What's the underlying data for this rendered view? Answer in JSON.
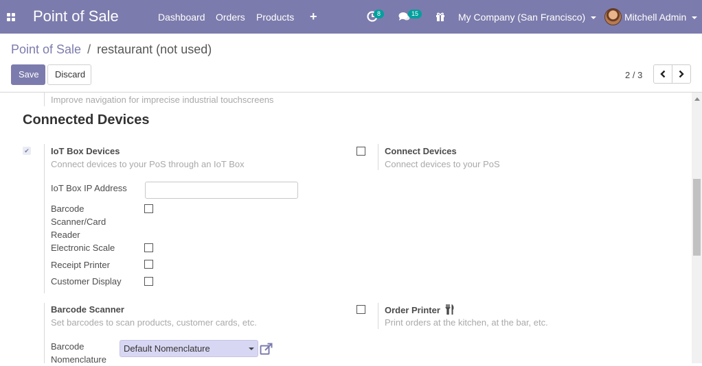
{
  "navbar": {
    "app_title": "Point of Sale",
    "menu": [
      "Dashboard",
      "Orders",
      "Products"
    ],
    "activity_count": "8",
    "messages_count": "15",
    "company": "My Company (San Francisco)",
    "user": "Mitchell Admin",
    "color": "#7c7bad"
  },
  "breadcrumb": {
    "parent": "Point of Sale",
    "separator": "/",
    "current": "restaurant (not used)"
  },
  "buttons": {
    "save": "Save",
    "discard": "Discard"
  },
  "pager": {
    "value": "2 / 3"
  },
  "content": {
    "top_help": "Improve navigation for imprecise industrial touchscreens",
    "section_title": "Connected Devices",
    "iot": {
      "title": "IoT Box Devices",
      "help": "Connect devices to your PoS through an IoT Box",
      "checked": true,
      "ip_label": "IoT Box IP Address",
      "ip_value": "",
      "devices": [
        {
          "label": "Barcode Scanner/Card Reader",
          "checked": false
        },
        {
          "label": "Electronic Scale",
          "checked": false
        },
        {
          "label": "Receipt Printer",
          "checked": false
        },
        {
          "label": "Customer Display",
          "checked": false
        }
      ]
    },
    "connect_devices": {
      "title": "Connect Devices",
      "help": "Connect devices to your PoS",
      "checked": false
    },
    "barcode_scanner": {
      "title": "Barcode Scanner",
      "help": "Set barcodes to scan products, customer cards, etc.",
      "nomenclature_label": "Barcode Nomenclature",
      "nomenclature_value": "Default Nomenclature"
    },
    "order_printer": {
      "title": "Order Printer",
      "help": "Print orders at the kitchen, at the bar, etc.",
      "checked": false
    }
  }
}
